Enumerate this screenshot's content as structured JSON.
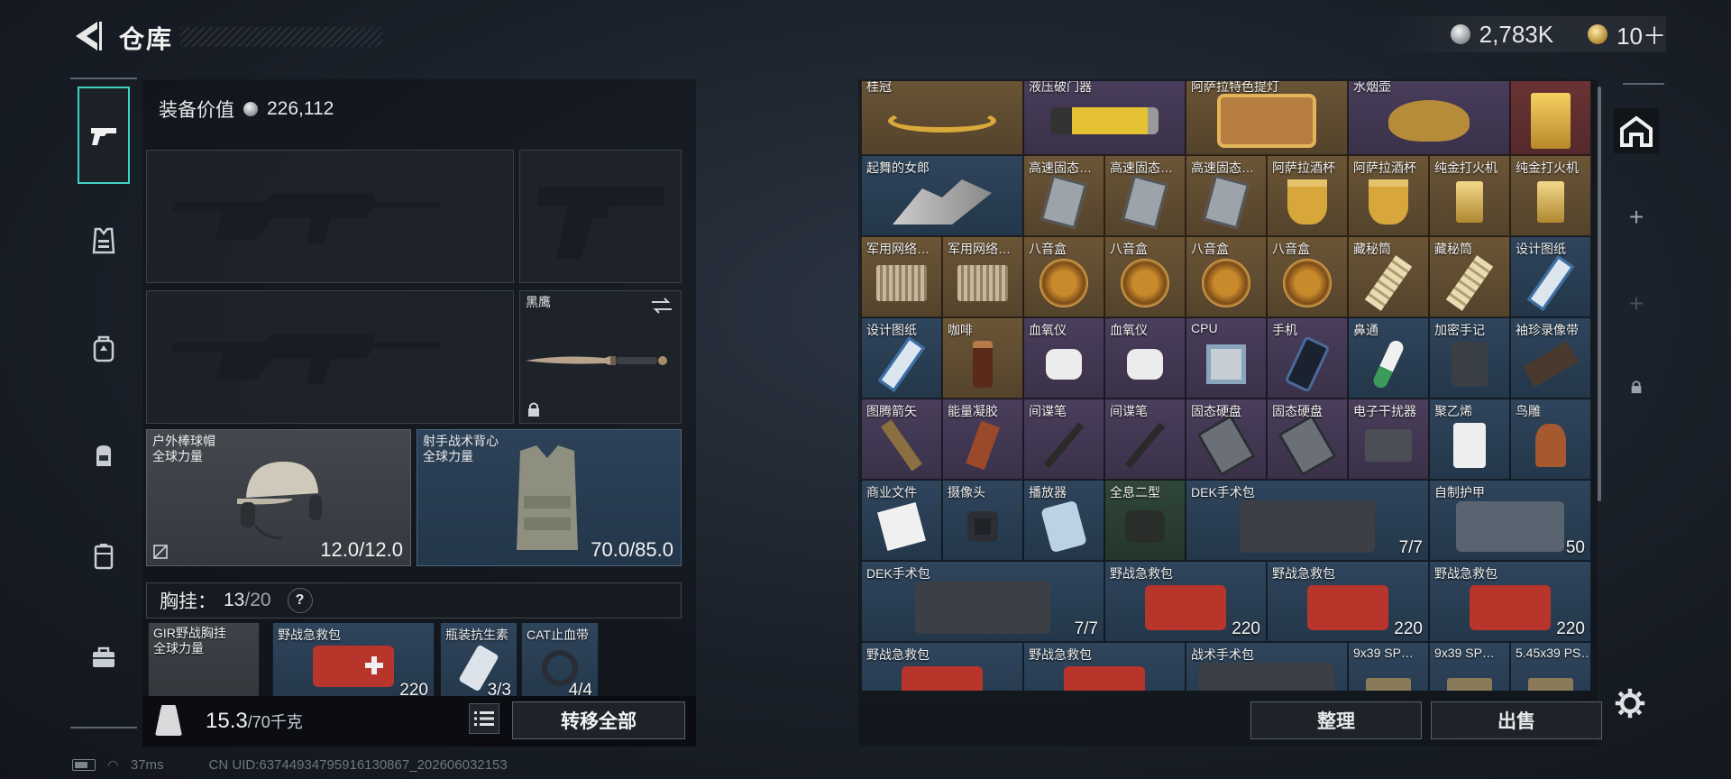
{
  "header": {
    "title": "仓库",
    "silver": "2,783K",
    "gold": "10＋"
  },
  "left": {
    "equip_value_label": "装备价值",
    "equip_value": "226,112",
    "knife_name": "黑鹰",
    "helmet": {
      "name": "户外棒球帽",
      "faction": "全球力量",
      "durability": "12.0/12.0"
    },
    "vest": {
      "name": "射手战术背心",
      "faction": "全球力量",
      "durability": "70.0/85.0"
    },
    "chest": {
      "label": "胸挂：",
      "current": "13",
      "max": "/20",
      "help": "?"
    },
    "rig_items": [
      {
        "name": "GIR野战胸挂",
        "sub": "全球力量",
        "count": ""
      },
      {
        "name": "野战急救包",
        "sub": "",
        "count": "220"
      },
      {
        "name": "瓶装抗生素",
        "sub": "",
        "count": "3/3"
      },
      {
        "name": "CAT止血带",
        "sub": "",
        "count": "4/4"
      }
    ],
    "weight": "15.3",
    "weight_max": "/70千克",
    "transfer_all": "转移全部"
  },
  "status": {
    "ping": "37ms",
    "uid": "CN UID:637449347959161308​67_202606032153"
  },
  "grid": {
    "items": [
      {
        "name": "桂冠",
        "count": "",
        "color": "gold",
        "icon": "laurel-crown-icon"
      },
      {
        "name": "液压破门器",
        "count": "",
        "color": "purple",
        "icon": "hydraulic-breacher-icon"
      },
      {
        "name": "阿萨拉特色提灯",
        "count": "",
        "color": "gold",
        "icon": "lantern-icon"
      },
      {
        "name": "水烟壶",
        "count": "",
        "color": "purple",
        "icon": "hookah-icon"
      },
      {
        "name": "",
        "count": "",
        "color": "red",
        "icon": "gold-bar-icon"
      },
      {
        "name": "起舞的女郎",
        "count": "",
        "color": "blue",
        "icon": "dancer-statue-icon"
      },
      {
        "name": "高速固态…",
        "count": "",
        "color": "gold",
        "icon": "ssd-icon"
      },
      {
        "name": "高速固态…",
        "count": "",
        "color": "gold",
        "icon": "ssd-icon"
      },
      {
        "name": "高速固态…",
        "count": "",
        "color": "gold",
        "icon": "ssd-icon"
      },
      {
        "name": "阿萨拉酒杯",
        "count": "",
        "color": "gold",
        "icon": "goblet-icon"
      },
      {
        "name": "阿萨拉酒杯",
        "count": "",
        "color": "gold",
        "icon": "goblet-icon"
      },
      {
        "name": "纯金打火机",
        "count": "",
        "color": "gold",
        "icon": "lighter-icon"
      },
      {
        "name": "纯金打火机",
        "count": "",
        "color": "gold",
        "icon": "lighter-icon"
      },
      {
        "name": "军用网络…",
        "count": "",
        "color": "gold",
        "icon": "network-module-icon"
      },
      {
        "name": "军用网络…",
        "count": "",
        "color": "gold",
        "icon": "network-module-icon"
      },
      {
        "name": "八音盒",
        "count": "",
        "color": "gold",
        "icon": "music-box-icon"
      },
      {
        "name": "八音盒",
        "count": "",
        "color": "gold",
        "icon": "music-box-icon"
      },
      {
        "name": "八音盒",
        "count": "",
        "color": "gold",
        "icon": "music-box-icon"
      },
      {
        "name": "八音盒",
        "count": "",
        "color": "gold",
        "icon": "music-box-icon"
      },
      {
        "name": "藏秘筒",
        "count": "",
        "color": "gold",
        "icon": "cryptex-icon"
      },
      {
        "name": "藏秘筒",
        "count": "",
        "color": "gold",
        "icon": "cryptex-icon"
      },
      {
        "name": "设计图纸",
        "count": "",
        "color": "blue",
        "icon": "blueprint-icon"
      },
      {
        "name": "设计图纸",
        "count": "",
        "color": "blue",
        "icon": "blueprint-icon"
      },
      {
        "name": "咖啡",
        "count": "",
        "color": "gold",
        "icon": "coffee-icon"
      },
      {
        "name": "血氧仪",
        "count": "",
        "color": "purple",
        "icon": "oximeter-icon"
      },
      {
        "name": "血氧仪",
        "count": "",
        "color": "purple",
        "icon": "oximeter-icon"
      },
      {
        "name": "CPU",
        "count": "",
        "color": "purple",
        "icon": "cpu-icon"
      },
      {
        "name": "手机",
        "count": "",
        "color": "purple",
        "icon": "phone-icon"
      },
      {
        "name": "鼻通",
        "count": "",
        "color": "blue",
        "icon": "nasal-inhaler-icon"
      },
      {
        "name": "加密手记",
        "count": "",
        "color": "blue",
        "icon": "notebook-icon"
      },
      {
        "name": "袖珍录像带",
        "count": "",
        "color": "blue",
        "icon": "cassette-icon"
      },
      {
        "name": "图腾箭矢",
        "count": "",
        "color": "purple",
        "icon": "totem-arrow-icon"
      },
      {
        "name": "能量凝胶",
        "count": "",
        "color": "purple",
        "icon": "energy-gel-icon"
      },
      {
        "name": "间谍笔",
        "count": "",
        "color": "purple",
        "icon": "spy-pen-icon"
      },
      {
        "name": "间谍笔",
        "count": "",
        "color": "purple",
        "icon": "spy-pen-icon"
      },
      {
        "name": "固态硬盘",
        "count": "",
        "color": "purple",
        "icon": "ssd-drive-icon"
      },
      {
        "name": "固态硬盘",
        "count": "",
        "color": "purple",
        "icon": "ssd-drive-icon"
      },
      {
        "name": "电子干扰器",
        "count": "",
        "color": "purple",
        "icon": "jammer-icon"
      },
      {
        "name": "聚乙烯",
        "count": "",
        "color": "blue",
        "icon": "polyethylene-icon"
      },
      {
        "name": "鸟雕",
        "count": "",
        "color": "blue",
        "icon": "bird-statue-icon"
      },
      {
        "name": "商业文件",
        "count": "",
        "color": "blue",
        "icon": "document-icon"
      },
      {
        "name": "摄像头",
        "count": "",
        "color": "blue",
        "icon": "camera-icon"
      },
      {
        "name": "播放器",
        "count": "",
        "color": "blue",
        "icon": "player-icon"
      },
      {
        "name": "全息二型",
        "count": "",
        "color": "green",
        "icon": "holo-sight-icon"
      },
      {
        "name": "DEK手术包",
        "count": "7/7",
        "color": "blue",
        "icon": "surgery-kit-icon"
      },
      {
        "name": "自制护甲",
        "count": "50",
        "color": "blue",
        "icon": "armor-plate-icon"
      },
      {
        "name": "DEK手术包",
        "count": "7/7",
        "color": "blue",
        "icon": "surgery-kit-icon"
      },
      {
        "name": "野战急救包",
        "count": "220",
        "color": "blue",
        "icon": "first-aid-icon"
      },
      {
        "name": "野战急救包",
        "count": "220",
        "color": "blue",
        "icon": "first-aid-icon"
      },
      {
        "name": "野战急救包",
        "count": "220",
        "color": "blue",
        "icon": "first-aid-icon"
      },
      {
        "name": "野战急救包",
        "count": "",
        "color": "blue",
        "icon": "first-aid-icon"
      },
      {
        "name": "野战急救包",
        "count": "",
        "color": "blue",
        "icon": "first-aid-icon"
      },
      {
        "name": "战术手术包",
        "count": "",
        "color": "blue",
        "icon": "surgery-kit-icon"
      },
      {
        "name": "9x39 SP…",
        "count": "",
        "color": "blue",
        "icon": "ammo-icon"
      },
      {
        "name": "9x39 SP…",
        "count": "",
        "color": "blue",
        "icon": "ammo-icon"
      },
      {
        "name": "5.45x39 PS…",
        "count": "",
        "color": "blue",
        "icon": "ammo-icon"
      }
    ],
    "sort": "整理",
    "sell": "出售"
  },
  "colors": {
    "accent": "#3fd1c3",
    "gold_cell": "#6b5536",
    "purple_cell": "#4a3e5c",
    "blue_cell": "#2f455c"
  }
}
